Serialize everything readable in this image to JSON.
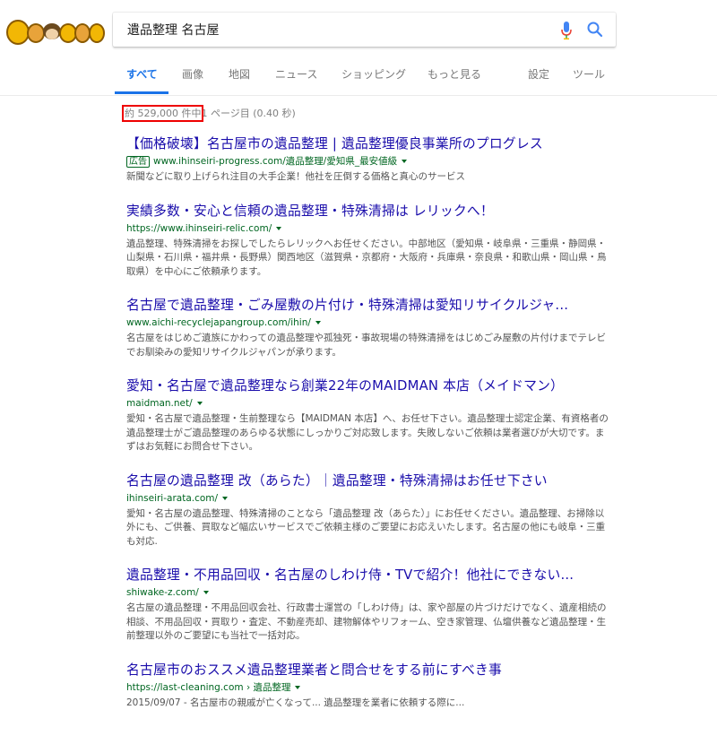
{
  "search": {
    "query": "遺品整理 名古屋"
  },
  "tabs": [
    {
      "label": "すべて"
    },
    {
      "label": "画像"
    },
    {
      "label": "地図"
    },
    {
      "label": "ニュース"
    },
    {
      "label": "ショッピング"
    },
    {
      "label": "もっと見る"
    },
    {
      "label": "設定"
    },
    {
      "label": "ツール"
    }
  ],
  "stats": {
    "count": "約 529,000 件中",
    "rest": "1 ページ目 (0.40 秒)"
  },
  "results": [
    {
      "title": "【価格破壊】名古屋市の遺品整理 | 遺品整理優良事業所のプログレス",
      "ad_label": "広告",
      "url": "www.ihinseiri-progress.com/遺品整理/愛知県_最安値級",
      "snippet": "新聞などに取り上げられ注目の大手企業！他社を圧倒する価格と真心のサービス"
    },
    {
      "title": "実績多数・安心と信頼の遺品整理・特殊清掃は レリックへ！",
      "url": "https://www.ihinseiri-relic.com/",
      "snippet": "遺品整理、特殊清掃をお探しでしたらレリックへお任せください。中部地区（愛知県・岐阜県・三重県・静岡県・山梨県・石川県・福井県・長野県）関西地区（滋賀県・京都府・大阪府・兵庫県・奈良県・和歌山県・岡山県・鳥取県）を中心にご依頼承ります。"
    },
    {
      "title": "名古屋で遺品整理・ごみ屋敷の片付け・特殊清掃は愛知リサイクルジャ...",
      "url": "www.aichi-recyclejapangroup.com/ihin/",
      "snippet": "名古屋をはじめご遺族にかわっての遺品整理や孤独死・事故現場の特殊清掃をはじめごみ屋敷の片付けまでテレビでお馴染みの愛知リサイクルジャパンが承ります。"
    },
    {
      "title": "愛知・名古屋で遺品整理なら創業22年のMAIDMAN 本店（メイドマン）",
      "url": "maidman.net/",
      "snippet": "愛知・名古屋で遺品整理・生前整理なら【MAIDMAN 本店】へ、お任せ下さい。遺品整理士認定企業、有資格者の遺品整理士がご遺品整理のあらゆる状態にしっかりご対応致します。失敗しないご依頼は業者選びが大切です。まずはお気軽にお問合せ下さい。"
    },
    {
      "title": "名古屋の遺品整理 改（あらた）｜遺品整理・特殊清掃はお任せ下さい",
      "url": "ihinseiri-arata.com/",
      "snippet": "愛知・名古屋の遺品整理、特殊清掃のことなら「遺品整理 改（あらた）」にお任せください。遺品整理、お掃除以外にも、ご供養、買取など幅広いサービスでご依頼主様のご要望にお応えいたします。名古屋の他にも岐阜・三重も対応."
    },
    {
      "title": "遺品整理・不用品回収・名古屋のしわけ侍・TVで紹介！他社にできない...",
      "url": "shiwake-z.com/",
      "snippet": "名古屋の遺品整理・不用品回収会社、行政書士運営の「しわけ侍」は、家や部屋の片づけだけでなく、遺産相続の相談、不用品回収・買取り・査定、不動産売却、建物解体やリフォーム、空き家管理、仏壇供養など遺品整理・生前整理以外のご要望にも当社で一括対応。"
    },
    {
      "title": "名古屋市のおススメ遺品整理業者と問合せをする前にすべき事",
      "url": "https://last-cleaning.com › 遺品整理",
      "snippet": "2015/09/07 - 名古屋市の親戚が亡くなって... 遺品整理を業者に依頼する際に..."
    }
  ]
}
